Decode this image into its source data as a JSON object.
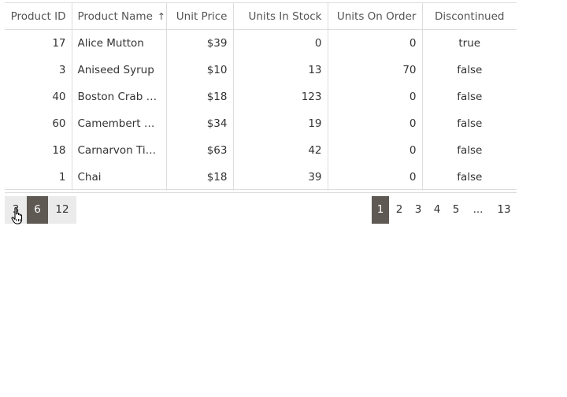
{
  "table": {
    "columns": [
      {
        "label": "Product ID",
        "sorted": false
      },
      {
        "label": "Product Name",
        "sorted": true,
        "sort_icon": "arrow-up-icon",
        "sort_glyph": "↑"
      },
      {
        "label": "Unit Price",
        "sorted": false
      },
      {
        "label": "Units In Stock",
        "sorted": false
      },
      {
        "label": "Units On Order",
        "sorted": false
      },
      {
        "label": "Discontinued",
        "sorted": false
      }
    ],
    "rows": [
      {
        "id": "17",
        "name": "Alice Mutton",
        "price": "$39",
        "stock": "0",
        "order": "0",
        "discontinued": "true"
      },
      {
        "id": "3",
        "name": "Aniseed Syrup",
        "price": "$10",
        "stock": "13",
        "order": "70",
        "discontinued": "false"
      },
      {
        "id": "40",
        "name": "Boston Crab M...",
        "price": "$18",
        "stock": "123",
        "order": "0",
        "discontinued": "false"
      },
      {
        "id": "60",
        "name": "Camembert Pie...",
        "price": "$34",
        "stock": "19",
        "order": "0",
        "discontinued": "false"
      },
      {
        "id": "18",
        "name": "Carnarvon Tigers",
        "price": "$63",
        "stock": "42",
        "order": "0",
        "discontinued": "false"
      },
      {
        "id": "1",
        "name": "Chai",
        "price": "$18",
        "stock": "39",
        "order": "0",
        "discontinued": "false"
      }
    ]
  },
  "page_sizes": [
    {
      "label": "3",
      "selected": false
    },
    {
      "label": "6",
      "selected": true
    },
    {
      "label": "12",
      "selected": false
    }
  ],
  "pager": {
    "pages": [
      "1",
      "2",
      "3",
      "4",
      "5",
      "...",
      "13"
    ],
    "current": "1"
  },
  "colors": {
    "accent": "#5f5954",
    "border": "#dddddd",
    "page_size_bg": "#ebebeb"
  }
}
